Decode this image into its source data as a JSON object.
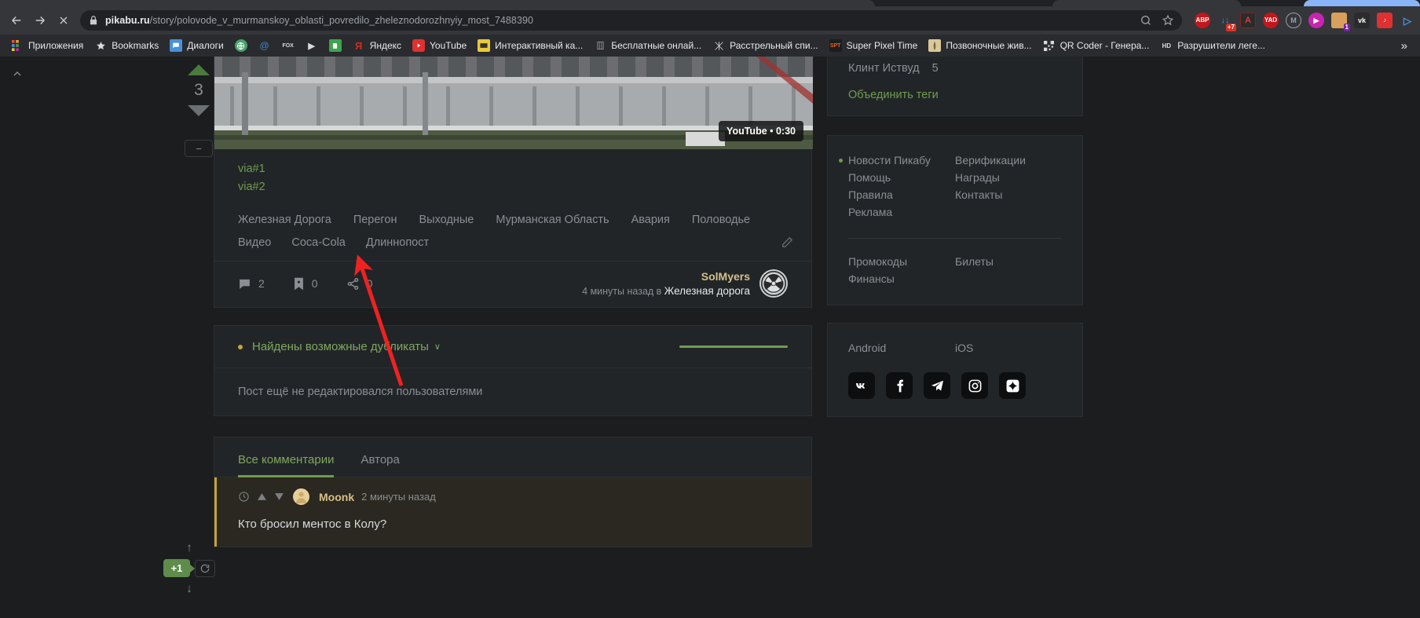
{
  "browser": {
    "url_domain": "pikabu.ru",
    "url_path": "/story/polovode_v_murmanskoy_oblasti_povredilo_zheleznodorozhnyiy_most_7488390",
    "back_icon": "back-arrow-icon",
    "forward_icon": "forward-arrow-icon",
    "stop_icon": "stop-loading-icon",
    "lock_icon": "lock-icon",
    "zoom_icon": "zoom-search-icon",
    "bookmark_icon": "star-icon",
    "extensions": [
      {
        "name": "adblock-plus-extension",
        "label": "ABP",
        "color": "#c4161c",
        "badge": ""
      },
      {
        "name": "downloader-extension",
        "label": "↓↓",
        "color": "#4a90d9",
        "badge": "+7"
      },
      {
        "name": "adobe-acrobat-extension",
        "label": "A",
        "color": "#b0000f",
        "badge": ""
      },
      {
        "name": "yandex-extension",
        "label": "YAD",
        "color": "#c4161c",
        "badge": ""
      },
      {
        "name": "mute-tab-extension",
        "label": "M",
        "color": "#6d7073",
        "badge": ""
      },
      {
        "name": "video-downloader-extension",
        "label": "▶",
        "color": "#c724b1",
        "badge": ""
      },
      {
        "name": "character-extension",
        "label": "",
        "color": "#d9a05b",
        "badge": "1"
      },
      {
        "name": "vk-extension",
        "label": "vk",
        "color": "#2b2b2b",
        "badge": ""
      },
      {
        "name": "music-extension",
        "label": "♪",
        "color": "#e03030",
        "badge": ""
      },
      {
        "name": "browser-profile-extension",
        "label": "▷",
        "color": "#2b6cb0",
        "badge": ""
      }
    ],
    "bookmarks": [
      {
        "name": "bookmark-apps",
        "label": "Приложения",
        "icon": "apps-grid-icon",
        "color": "#e8a13a"
      },
      {
        "name": "bookmark-bookmarks",
        "label": "Bookmarks",
        "icon": "star-icon",
        "color": "#d8dadd"
      },
      {
        "name": "bookmark-dialogi",
        "label": "Диалоги",
        "icon": "chat-icon",
        "color": "#4a90d9"
      },
      {
        "name": "bookmark-globe",
        "label": "",
        "icon": "globe-icon",
        "color": "#4aa06a"
      },
      {
        "name": "bookmark-at",
        "label": "",
        "icon": "at-sign-icon",
        "color": "#3a7fd5"
      },
      {
        "name": "bookmark-fox",
        "label": "",
        "icon": "fox-icon",
        "color": "#d8dadd"
      },
      {
        "name": "bookmark-play",
        "label": "",
        "icon": "play-triangle-icon",
        "color": "#d8dadd"
      },
      {
        "name": "bookmark-green-app",
        "label": "",
        "icon": "green-app-icon",
        "color": "#3fa34d"
      },
      {
        "name": "bookmark-yandex",
        "label": "Яндекс",
        "icon": "yandex-icon",
        "color": "#d52b1e"
      },
      {
        "name": "bookmark-youtube",
        "label": "YouTube",
        "icon": "youtube-icon",
        "color": "#e03030"
      },
      {
        "name": "bookmark-interactive-map",
        "label": "Интерактивный ка...",
        "icon": "map-icon",
        "color": "#e8c93a"
      },
      {
        "name": "bookmark-free-online",
        "label": "Бесплатные онлай...",
        "icon": "book-icon",
        "color": "#8a8f94"
      },
      {
        "name": "bookmark-rasstrelnyi",
        "label": "Расстрельный спи...",
        "icon": "crossed-icon",
        "color": "#d8dadd"
      },
      {
        "name": "bookmark-super-pixel-time",
        "label": "Super Pixel Time",
        "icon": "spt-icon",
        "color": "#e8621a"
      },
      {
        "name": "bookmark-pozvonochnye",
        "label": "Позвоночные жив...",
        "icon": "feather-icon",
        "color": "#d9c89a"
      },
      {
        "name": "bookmark-qr-coder",
        "label": "QR Coder - Генера...",
        "icon": "qr-code-icon",
        "color": "#d8dadd"
      },
      {
        "name": "bookmark-razrusiteli",
        "label": "Разрушители леге...",
        "icon": "hd-icon",
        "color": "#d8dadd"
      }
    ],
    "overflow_label": "»"
  },
  "rating": {
    "value": "3",
    "up_icon": "upvote-triangle-icon",
    "down_icon": "downvote-triangle-icon",
    "minus_label": "−"
  },
  "post": {
    "video": {
      "badge": "YouTube • 0:30",
      "play_icon": "play-icon"
    },
    "via_links": [
      "via#1",
      "via#2"
    ],
    "tags": [
      "Железная Дорога",
      "Перегон",
      "Выходные",
      "Мурманская Область",
      "Авария",
      "Половодье",
      "Видео",
      "Coca-Cola",
      "Длиннопост"
    ],
    "edit_icon": "pencil-edit-icon",
    "stats": {
      "comments_count": "2",
      "saves_count": "0",
      "shares_count": "0",
      "comments_icon": "comment-icon",
      "save_icon": "bookmark-save-icon",
      "share_icon": "share-icon"
    },
    "author": {
      "name": "SolMyers",
      "time": "4 минуты назад в",
      "community": "Железная дорога",
      "avatar_icon": "radiation-avatar-icon"
    }
  },
  "duplicates": {
    "title": "Найдены возможные дубликаты",
    "chevron": "∨",
    "body_text": "Пост ещё не редактировался пользователями"
  },
  "comments": {
    "tabs": [
      {
        "label": "Все комментарии",
        "active": true
      },
      {
        "label": "Автора",
        "active": false
      }
    ],
    "items": [
      {
        "user": "Moonk",
        "time": "2 минуты назад",
        "text": "Кто бросил ментос в Колу?",
        "clock_icon": "clock-icon",
        "up_icon": "upvote-triangle-icon",
        "down_icon": "downvote-triangle-icon"
      }
    ]
  },
  "vote_widget": {
    "up_arrow": "↑",
    "down_arrow": "↓",
    "badge": "+1",
    "refresh_icon": "refresh-icon"
  },
  "sidebar": {
    "tag_suggestion": {
      "label": "Клинт Иствуд",
      "count": "5",
      "merge_label": "Объединить теги"
    },
    "links_col1": [
      "Новости Пикабу",
      "Помощь",
      "Правила",
      "Реклама"
    ],
    "links_col2": [
      "Верификации",
      "Награды",
      "Контакты"
    ],
    "links2_col1": [
      "Промокоды",
      "Финансы"
    ],
    "links2_col2": [
      "Билеты"
    ],
    "apps": [
      "Android",
      "iOS"
    ],
    "socials": [
      {
        "name": "vk-icon",
        "label": "VK"
      },
      {
        "name": "facebook-icon",
        "label": "Facebook"
      },
      {
        "name": "telegram-icon",
        "label": "Telegram"
      },
      {
        "name": "instagram-icon",
        "label": "Instagram"
      },
      {
        "name": "pikabu-star-icon",
        "label": "Pikabu"
      }
    ]
  },
  "annotation": {
    "arrow_color": "#ef2222",
    "points_to": "Coca-Cola"
  },
  "colors": {
    "accent_green": "#6f9c4e",
    "page_bg": "#1b1d1f",
    "card_bg": "#222528",
    "text_muted": "#8a8f94"
  }
}
